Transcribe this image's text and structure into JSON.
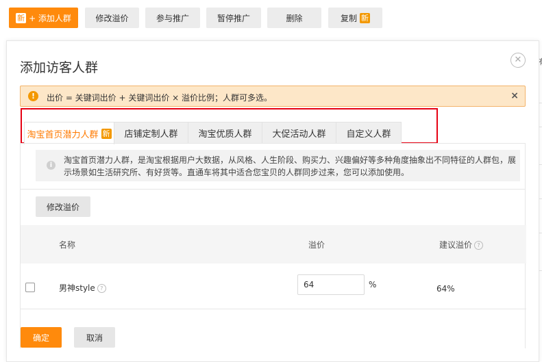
{
  "toolbar": {
    "add_badge": "新",
    "add_label": "+ 添加人群",
    "modify_bid": "修改溢价",
    "join_promo": "参与推广",
    "pause_promo": "暂停推广",
    "delete": "删除",
    "copy": "复制",
    "copy_badge": "新"
  },
  "background": {
    "right_text": "有"
  },
  "dialog": {
    "title": "添加访客人群",
    "close_icon": "close-circle-icon",
    "alert": {
      "icon": "!",
      "text": "出价 = 关键词出价 + 关键词出价 × 溢价比例；人群可多选。",
      "close": "×"
    },
    "tabs": [
      {
        "label": "淘宝首页潜力人群",
        "badge": "新",
        "active": true
      },
      {
        "label": "店铺定制人群",
        "active": false
      },
      {
        "label": "淘宝优质人群",
        "active": false
      },
      {
        "label": "大促活动人群",
        "active": false
      },
      {
        "label": "自定义人群",
        "active": false
      }
    ],
    "info": {
      "icon": "i",
      "text": "淘宝首页潜力人群，是淘宝根据用户大数据，从风格、人生阶段、购买力、兴趣偏好等多种角度抽象出不同特征的人群包，展示场景如生活研究所、有好货等。直通车将其中适合您宝贝的人群同步过来，您可以添加使用。"
    },
    "modify_button": "修改溢价",
    "table": {
      "headers": {
        "name": "名称",
        "bid": "溢价",
        "suggest": "建议溢价"
      },
      "rows": [
        {
          "name": "男神style",
          "bid_value": "64",
          "unit": "%",
          "suggest": "64%"
        }
      ]
    },
    "ok_button": "确定",
    "cancel_button": "取消"
  },
  "colors": {
    "accent": "#ff8a0c",
    "highlight": "#e60012",
    "alert_bg": "#fde7c8"
  }
}
